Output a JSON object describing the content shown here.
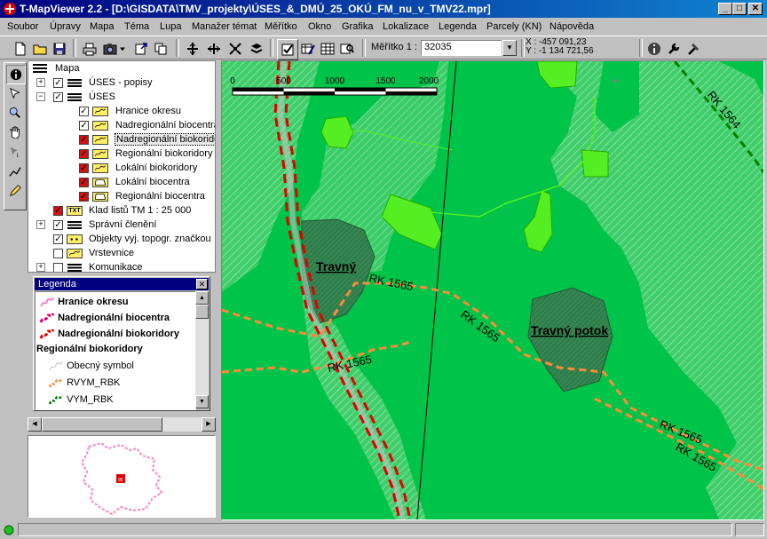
{
  "window": {
    "title": "T-MapViewer 2.2 - [D:\\GISDATA\\TMV_projekty\\ÚSES_&_DMÚ_25_OKÚ_FM_nu_v_TMV22.mpr]",
    "minimize": "_",
    "maximize": "□",
    "close": "✕"
  },
  "menu": [
    "Soubor",
    "Úpravy",
    "Mapa",
    "Téma",
    "Lupa",
    "Manažer témat",
    "Měřítko",
    "Okno",
    "Grafika",
    "Lokalizace",
    "Legenda",
    "Parcely (KN)",
    "Nápověda"
  ],
  "toolbar": {
    "scale_label": "Měřítko 1 :",
    "scale_value": "32035",
    "coord_x": "X : -457 091,23",
    "coord_y": "Y : -1 134 721,56"
  },
  "tree": {
    "root": "Mapa",
    "items": [
      {
        "label": "ÚSES - popisy"
      },
      {
        "label": "ÚSES"
      },
      {
        "label": "Hranice okresu"
      },
      {
        "label": "Nadregionální biocentra"
      },
      {
        "label": "Nadregionální biokorido"
      },
      {
        "label": "Regionální biokoridory"
      },
      {
        "label": "Lokální biokoridory"
      },
      {
        "label": "Lokální biocentra"
      },
      {
        "label": "Regionální biocentra"
      },
      {
        "label": "Klad listů TM 1 : 25 000",
        "icon_text": "TXT"
      },
      {
        "label": "Správní členění"
      },
      {
        "label": "Objekty vyj. topogr. značkou"
      },
      {
        "label": "Vrstevnice"
      },
      {
        "label": "Komunikace"
      }
    ]
  },
  "legend": {
    "title": "Legenda",
    "close": "✕",
    "rows": [
      {
        "label": "Hranice okresu",
        "color": "#ff80c0"
      },
      {
        "label": "Nadregionální biocentra",
        "color": "#e0006a"
      },
      {
        "label": "Nadregionální biokoridory",
        "color": "#e00000"
      },
      {
        "label": "Regionální biokoridory",
        "color": ""
      },
      {
        "label": "Obecný symbol",
        "color": "#c0c0c0"
      },
      {
        "label": "RVYM_RBK",
        "color": "#ff8a3a"
      },
      {
        "label": "VYM_RBK",
        "color": "#008000"
      }
    ]
  },
  "overview": {
    "marker": "8€"
  },
  "map": {
    "scalebar_ticks": [
      "0",
      "500",
      "1000",
      "1500",
      "2000"
    ],
    "labels": {
      "travny1": "Travný",
      "travny2": "Travný potok",
      "rk1565_a": "RK 1565",
      "rk1565_b": "RK 1565",
      "rk1565_c": "RK 1565",
      "rk1565_d": "RK 1565",
      "rk1565_e": "RK 1565",
      "rk1564": "RK 1564"
    },
    "colors": {
      "base": "#00c44a",
      "hatched": "#6fd08a",
      "forest_dark": "#2e7d4a",
      "light_patch": "#55ee22",
      "corridor": "#ff8a3a",
      "nad_biokoridor": "#e00000"
    }
  }
}
